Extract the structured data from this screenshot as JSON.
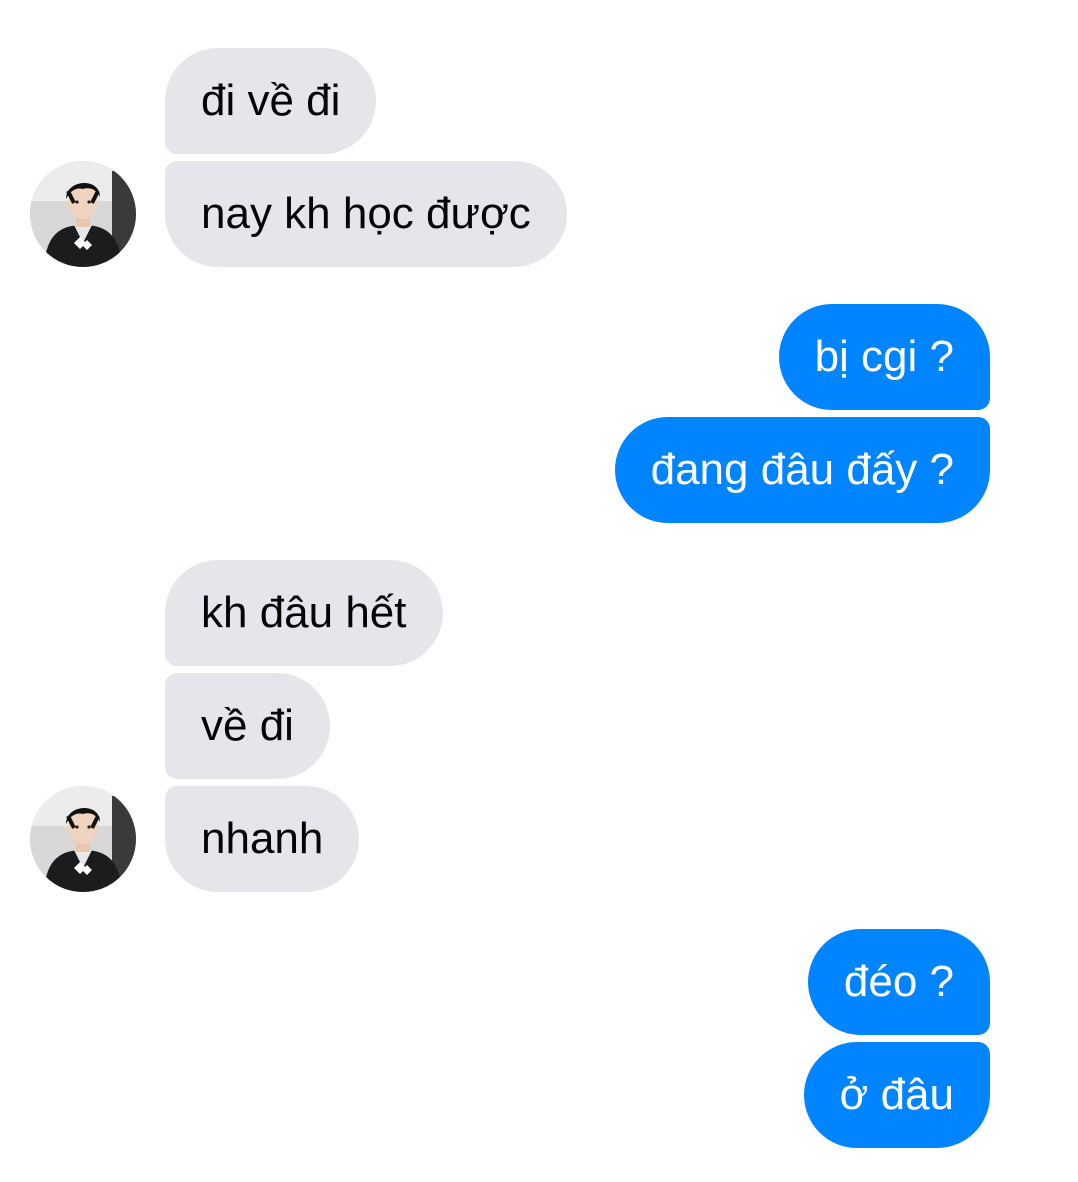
{
  "colors": {
    "incoming_bubble": "#e4e6eb",
    "incoming_text": "#050505",
    "outgoing_bubble": "#0084ff",
    "outgoing_text": "#ffffff"
  },
  "conversation": {
    "groups": [
      {
        "sender": "contact",
        "avatar_icon": "contact-avatar",
        "messages": [
          "đi về đi",
          "nay kh học được"
        ]
      },
      {
        "sender": "self",
        "messages": [
          "bị cgi ?",
          "đang đâu đấy ?"
        ]
      },
      {
        "sender": "contact",
        "avatar_icon": "contact-avatar",
        "messages": [
          "kh đâu hết",
          "về đi",
          "nhanh"
        ]
      },
      {
        "sender": "self",
        "messages": [
          "đéo ?",
          "ở đâu"
        ]
      }
    ]
  }
}
